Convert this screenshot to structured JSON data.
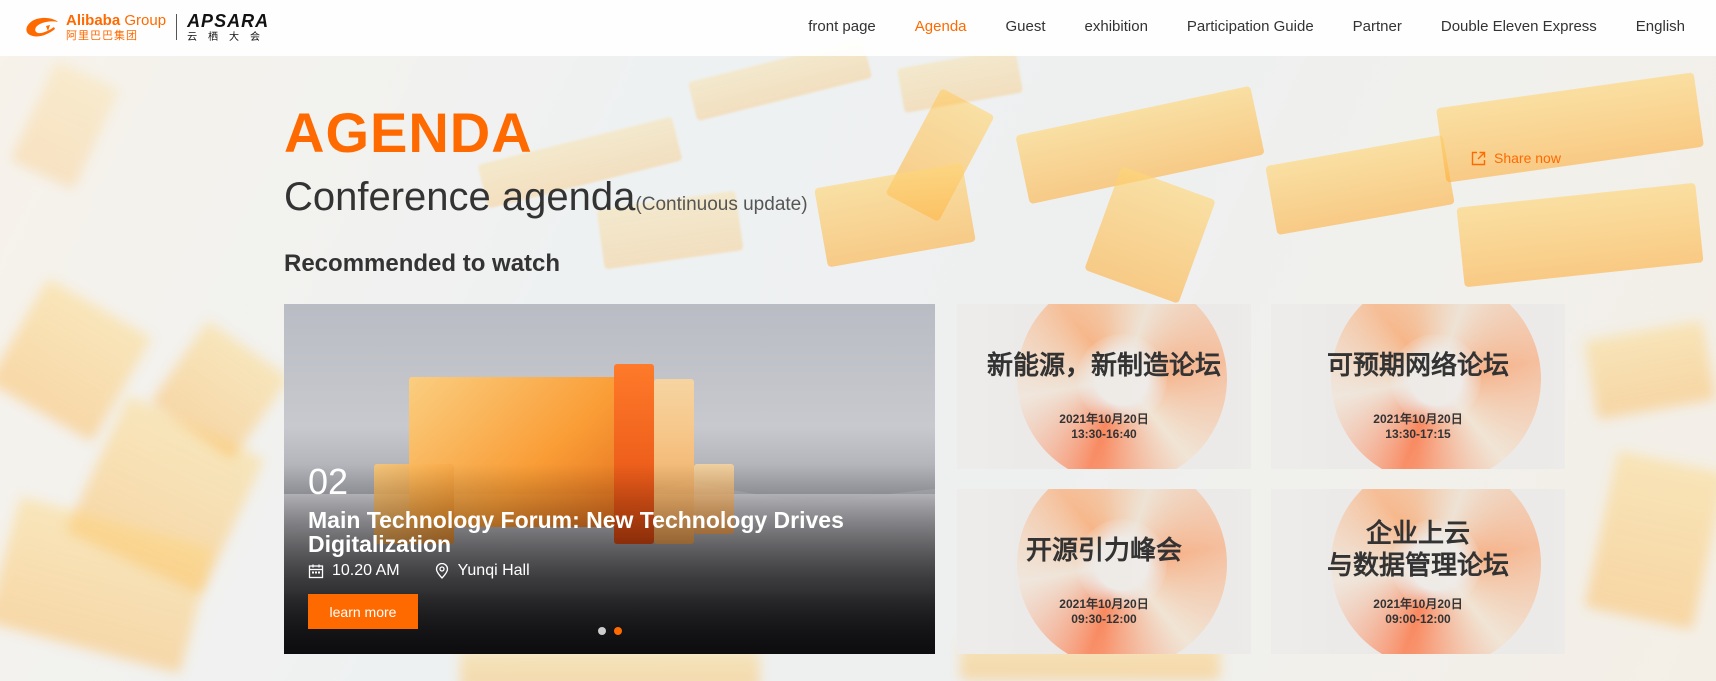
{
  "brand": {
    "alibaba_en": "Alibaba",
    "alibaba_group": "Group",
    "alibaba_cn": "阿里巴巴集团",
    "apsara_en": "APSARA",
    "apsara_cn": "云栖大会"
  },
  "nav": {
    "items": [
      {
        "label": "front page",
        "active": false
      },
      {
        "label": "Agenda",
        "active": true
      },
      {
        "label": "Guest",
        "active": false
      },
      {
        "label": "exhibition",
        "active": false
      },
      {
        "label": "Participation Guide",
        "active": false
      },
      {
        "label": "Partner",
        "active": false
      },
      {
        "label": "Double Eleven Express",
        "active": false
      },
      {
        "label": "English",
        "active": false
      }
    ]
  },
  "page": {
    "heading": "AGENDA",
    "subheading": "Conference agenda",
    "subheading_note": "(Continuous update)",
    "share_label": "Share now",
    "section_title": "Recommended to watch"
  },
  "featured": {
    "number": "02",
    "title": "Main Technology Forum: New Technology Drives Digitalization",
    "time": "10.20 AM",
    "location": "Yunqi Hall",
    "button_label": "learn more",
    "slides": 2,
    "active_slide": 2
  },
  "forums": [
    {
      "title_line1": "新能源，新制造论坛",
      "title_line2": "",
      "date": "2021年10月20日",
      "time": "13:30-16:40"
    },
    {
      "title_line1": "可预期网络论坛",
      "title_line2": "",
      "date": "2021年10月20日",
      "time": "13:30-17:15"
    },
    {
      "title_line1": "开源引力峰会",
      "title_line2": "",
      "date": "2021年10月20日",
      "time": "09:30-12:00"
    },
    {
      "title_line1": "企业上云",
      "title_line2": "与数据管理论坛",
      "date": "2021年10月20日",
      "time": "09:00-12:00"
    }
  ],
  "colors": {
    "accent": "#ff6a00",
    "text": "#333333"
  },
  "icons": {
    "share": "share-icon",
    "calendar": "calendar-icon",
    "location": "location-pin-icon"
  }
}
